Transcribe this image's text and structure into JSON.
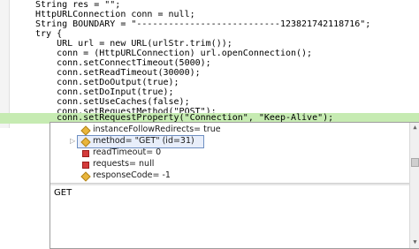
{
  "code": {
    "lines": [
      "String res = \"\";",
      "HttpURLConnection conn = null;",
      "String BOUNDARY = \"---------------------------123821742118716\";",
      "try {",
      "    URL url = new URL(urlStr.trim());",
      "    conn = (HttpURLConnection) url.openConnection();",
      "    conn.setConnectTimeout(5000);",
      "    conn.setReadTimeout(30000);",
      "    conn.setDoOutput(true);",
      "    conn.setDoInput(true);",
      "    conn.setUseCaches(false);",
      "    conn.setRequestMethod(\"POST\");",
      "    conn.setRequestProperty(\"Connection\", \"Keep-Alive\");"
    ],
    "highlighted_index": 12
  },
  "debug_popup": {
    "rows": [
      {
        "icon": "field-diamond-icon",
        "text": "instanceFollowRedirects= true",
        "expandable": false
      },
      {
        "icon": "field-diamond-icon",
        "text": "method= \"GET\" (id=31)",
        "expandable": true,
        "selected": true
      },
      {
        "icon": "private-field-icon",
        "text": "readTimeout= 0",
        "expandable": false
      },
      {
        "icon": "private-field-icon",
        "text": "requests= null",
        "expandable": false
      },
      {
        "icon": "field-diamond-icon",
        "text": "responseCode= -1",
        "expandable": false
      }
    ],
    "detail_value": "GET"
  }
}
